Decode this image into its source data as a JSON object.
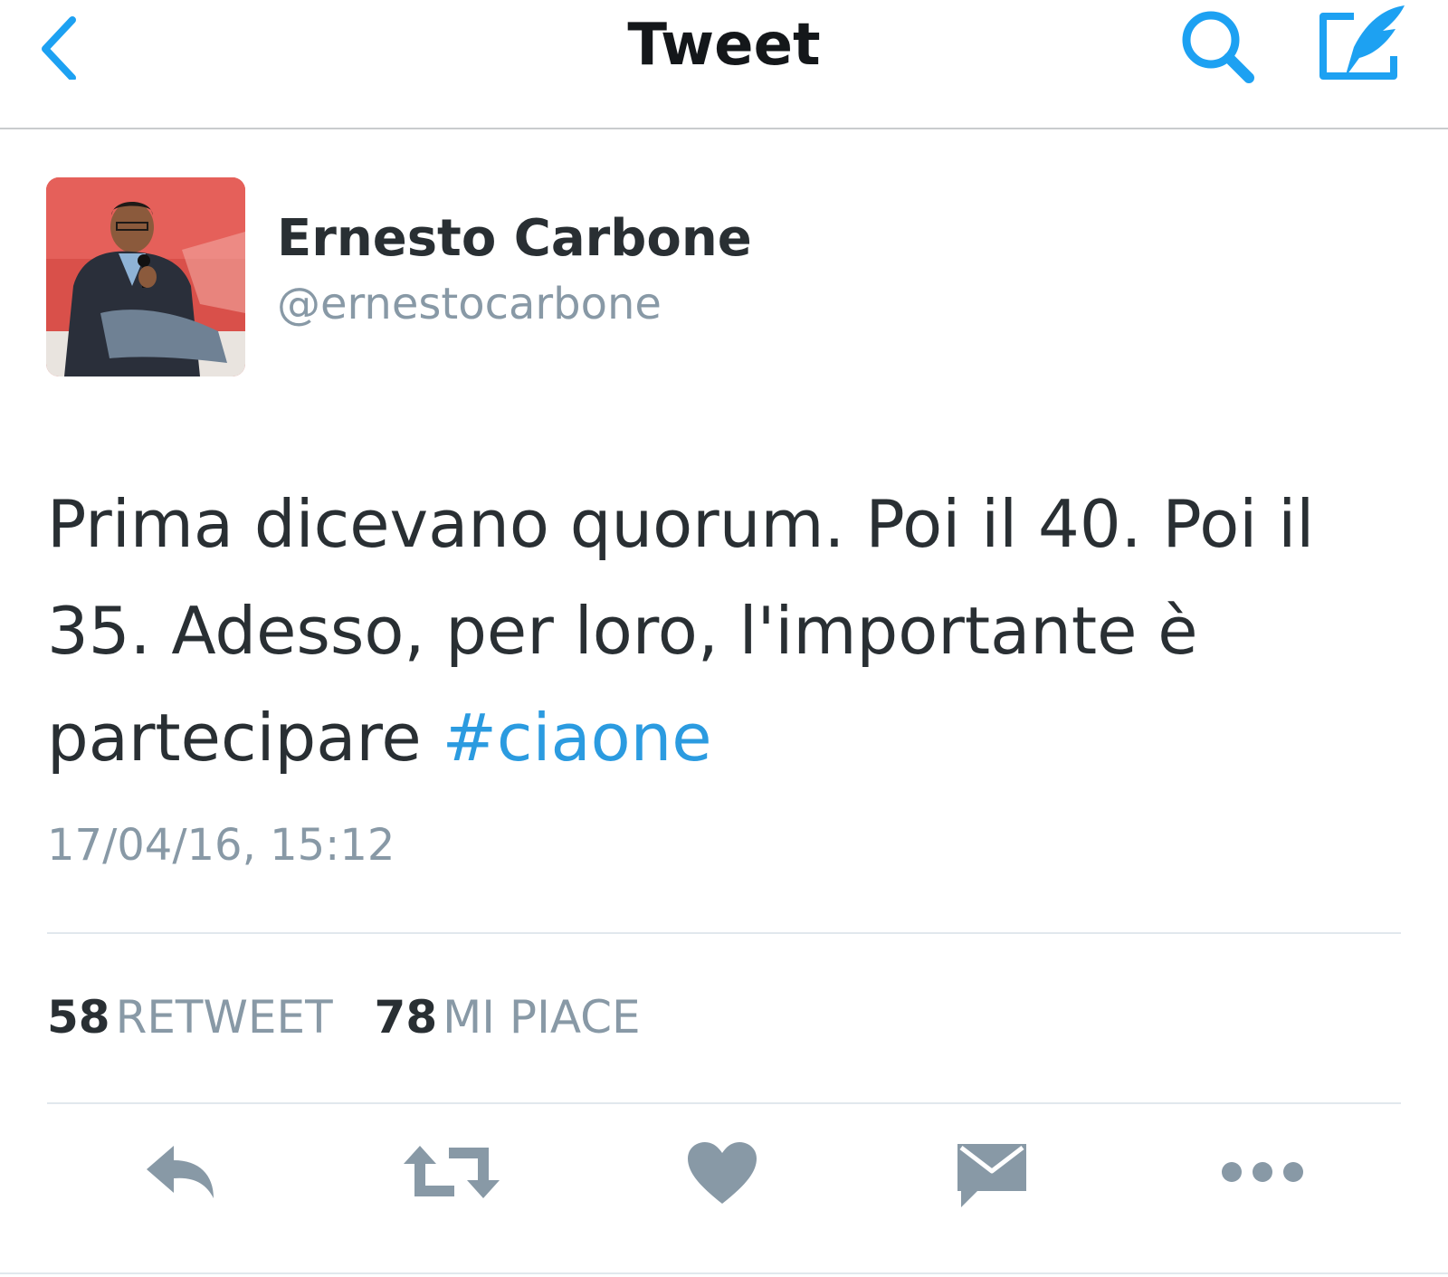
{
  "navbar": {
    "title": "Tweet",
    "back_icon": "chevron-left-icon",
    "search_icon": "search-icon",
    "compose_icon": "compose-tweet-icon",
    "accent_color": "#1da1f2"
  },
  "author": {
    "name": "Ernesto Carbone",
    "handle": "@ernestocarbone"
  },
  "tweet": {
    "text": "Prima dicevano quorum. Poi il 40. Poi il 35. Adesso, per loro, l'importante è partecipare",
    "hashtag": "#ciaone",
    "timestamp": "17/04/16, 15:12",
    "hashtag_color": "#2b9be0"
  },
  "stats": {
    "retweets": {
      "count": "58",
      "label": "RETWEET"
    },
    "likes": {
      "count": "78",
      "label": "MI PIACE"
    }
  },
  "actions": {
    "reply": "reply-icon",
    "retweet": "retweet-icon",
    "like": "heart-icon",
    "message": "envelope-icon",
    "more": "more-dots-icon",
    "icon_color": "#8899a6"
  }
}
